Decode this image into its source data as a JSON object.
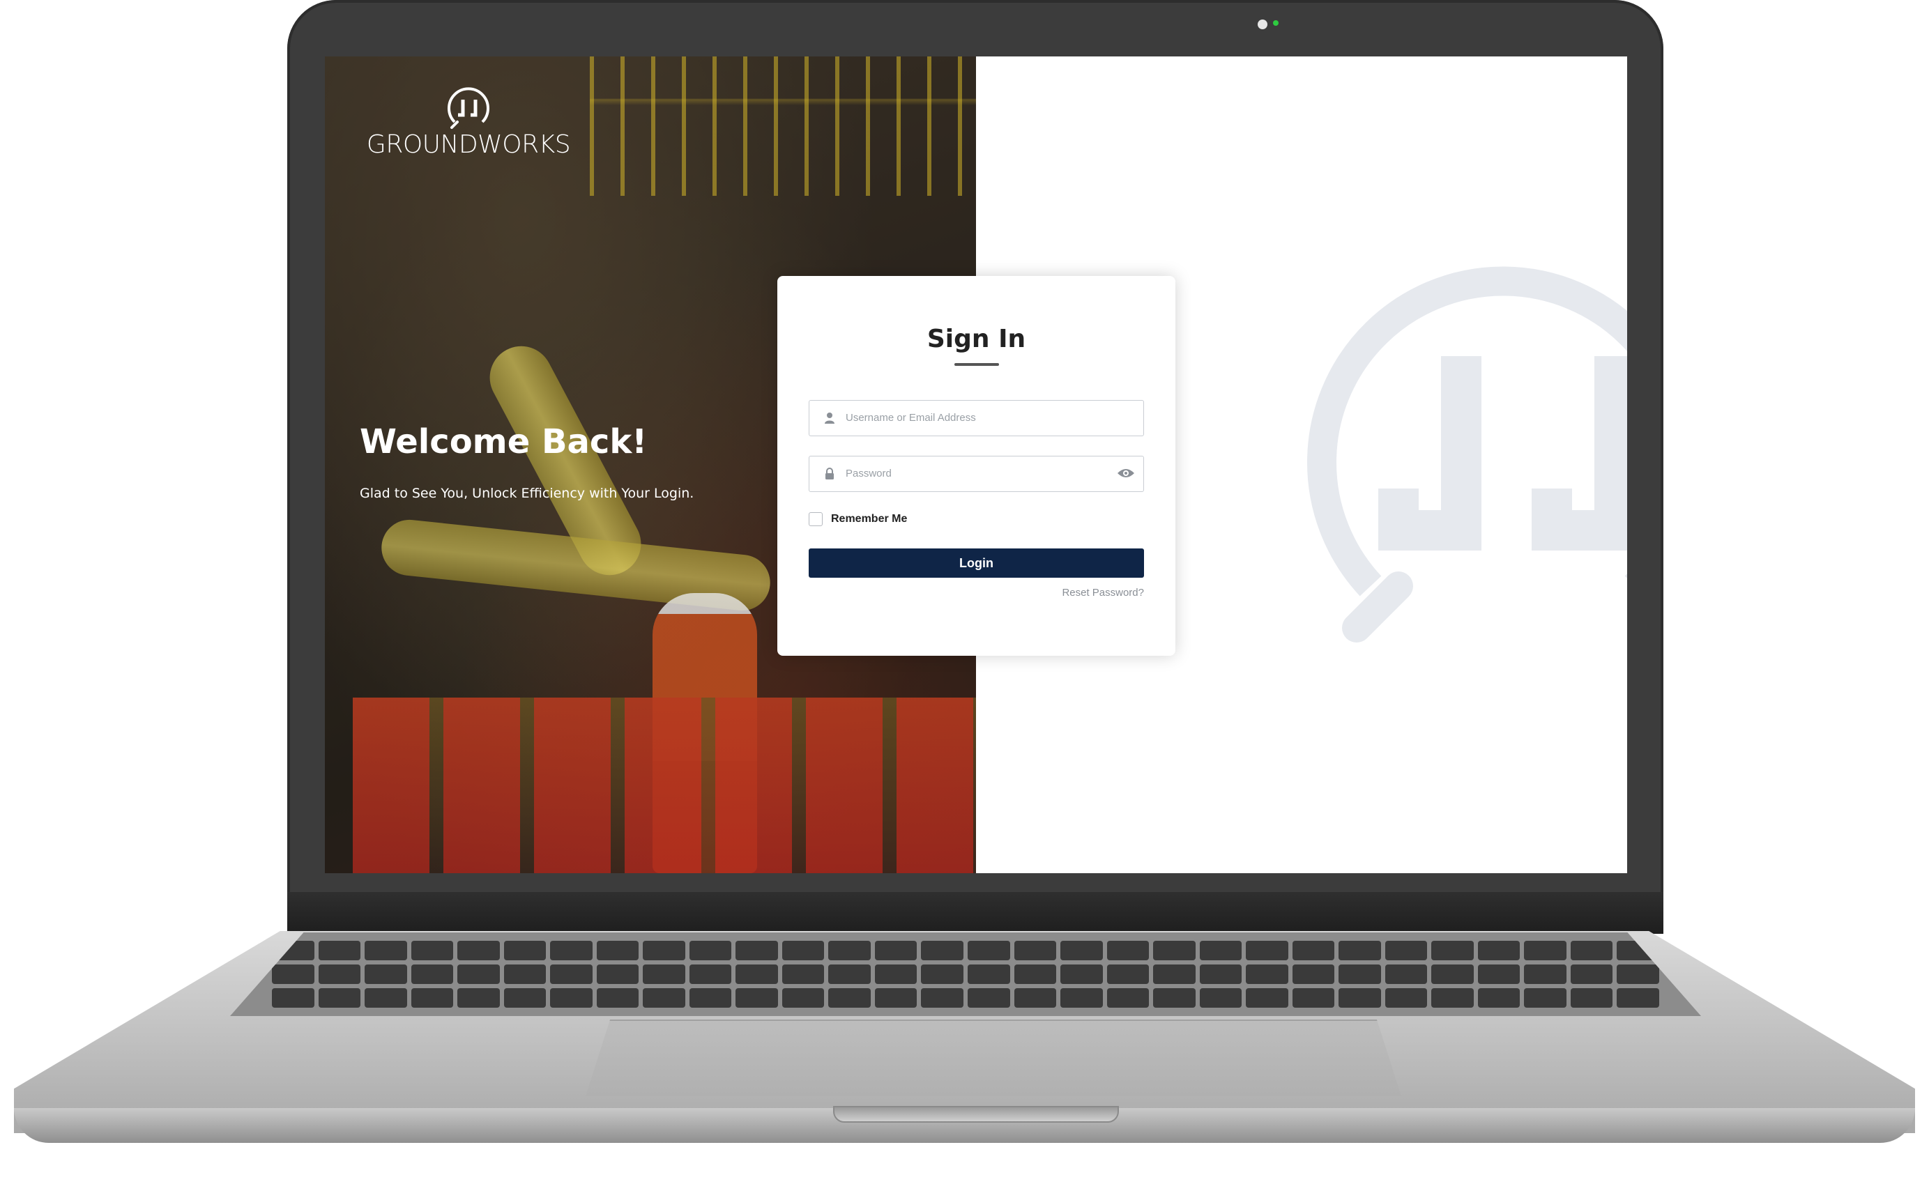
{
  "brand": {
    "logo_text": "GROUNDWORKS",
    "logo_monogram": "JJ"
  },
  "hero": {
    "heading": "Welcome Back!",
    "subheading": "Glad to See You, Unlock Efficiency with Your Login."
  },
  "login": {
    "title": "Sign In",
    "username_placeholder": "Username or Email Address",
    "password_placeholder": "Password",
    "remember_label": "Remember Me",
    "submit_label": "Login",
    "reset_label": "Reset Password?"
  },
  "icons": {
    "username": "user-icon",
    "password": "lock-icon",
    "reveal": "eye-icon"
  },
  "colors": {
    "primary": "#0f2547",
    "watermark": "#e6e9ee",
    "card_bg": "#ffffff"
  }
}
